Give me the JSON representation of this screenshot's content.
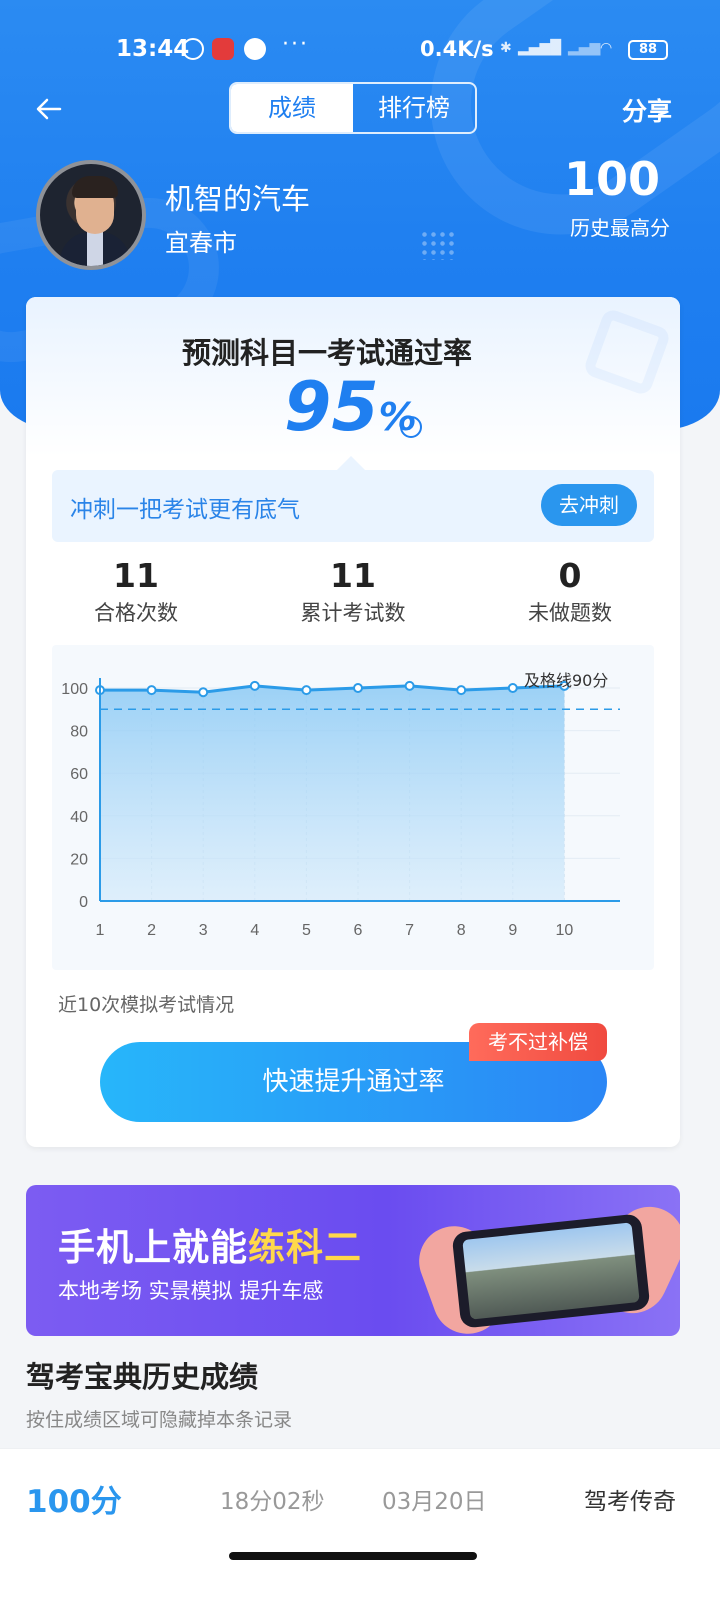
{
  "status_bar": {
    "time": "13:44",
    "net_speed": "0.4K/s",
    "battery": "88",
    "more": "···"
  },
  "nav": {
    "tabs": [
      {
        "label": "成绩",
        "active": true
      },
      {
        "label": "排行榜",
        "active": false
      }
    ],
    "share_label": "分享"
  },
  "profile": {
    "name": "机智的汽车",
    "city": "宜春市",
    "best_score": "100",
    "best_score_label": "历史最高分"
  },
  "prediction": {
    "title": "预测科目一考试通过率",
    "rate": "95",
    "unit": "%",
    "sprint_text": "冲刺一把考试更有底气",
    "sprint_button": "去冲刺"
  },
  "stats": [
    {
      "value": "11",
      "label": "合格次数"
    },
    {
      "value": "11",
      "label": "累计考试数"
    },
    {
      "value": "0",
      "label": "未做题数"
    }
  ],
  "chart_caption": "近10次模拟考试情况",
  "chart_data": {
    "type": "area",
    "x": [
      1,
      2,
      3,
      4,
      5,
      6,
      7,
      8,
      9,
      10
    ],
    "series": [
      {
        "values": [
          99,
          99,
          98,
          101,
          99,
          100,
          101,
          99,
          100,
          101
        ]
      }
    ],
    "ylim": [
      0,
      100
    ],
    "yticks": [
      0,
      20,
      40,
      60,
      80,
      100
    ],
    "xticks": [
      "1",
      "2",
      "3",
      "4",
      "5",
      "6",
      "7",
      "8",
      "9",
      "10"
    ],
    "threshold": {
      "value": 90,
      "label": "及格线90分"
    },
    "colors": {
      "line": "#2b9be8",
      "fill": "#a9d8f7",
      "threshold": "#2b9be8"
    },
    "grid": true
  },
  "cta": {
    "label": "快速提升通过率",
    "badge": "考不过补偿"
  },
  "banner": {
    "title_part1": "手机上就能",
    "title_highlight": "练科二",
    "subtitle": "本地考场 实景模拟 提升车感"
  },
  "history": {
    "title": "驾考宝典历史成绩",
    "hint": "按住成绩区域可隐藏掉本条记录",
    "rows": [
      {
        "score": "100分",
        "duration": "18分02秒",
        "date": "03月20日",
        "title": "驾考传奇"
      }
    ]
  }
}
